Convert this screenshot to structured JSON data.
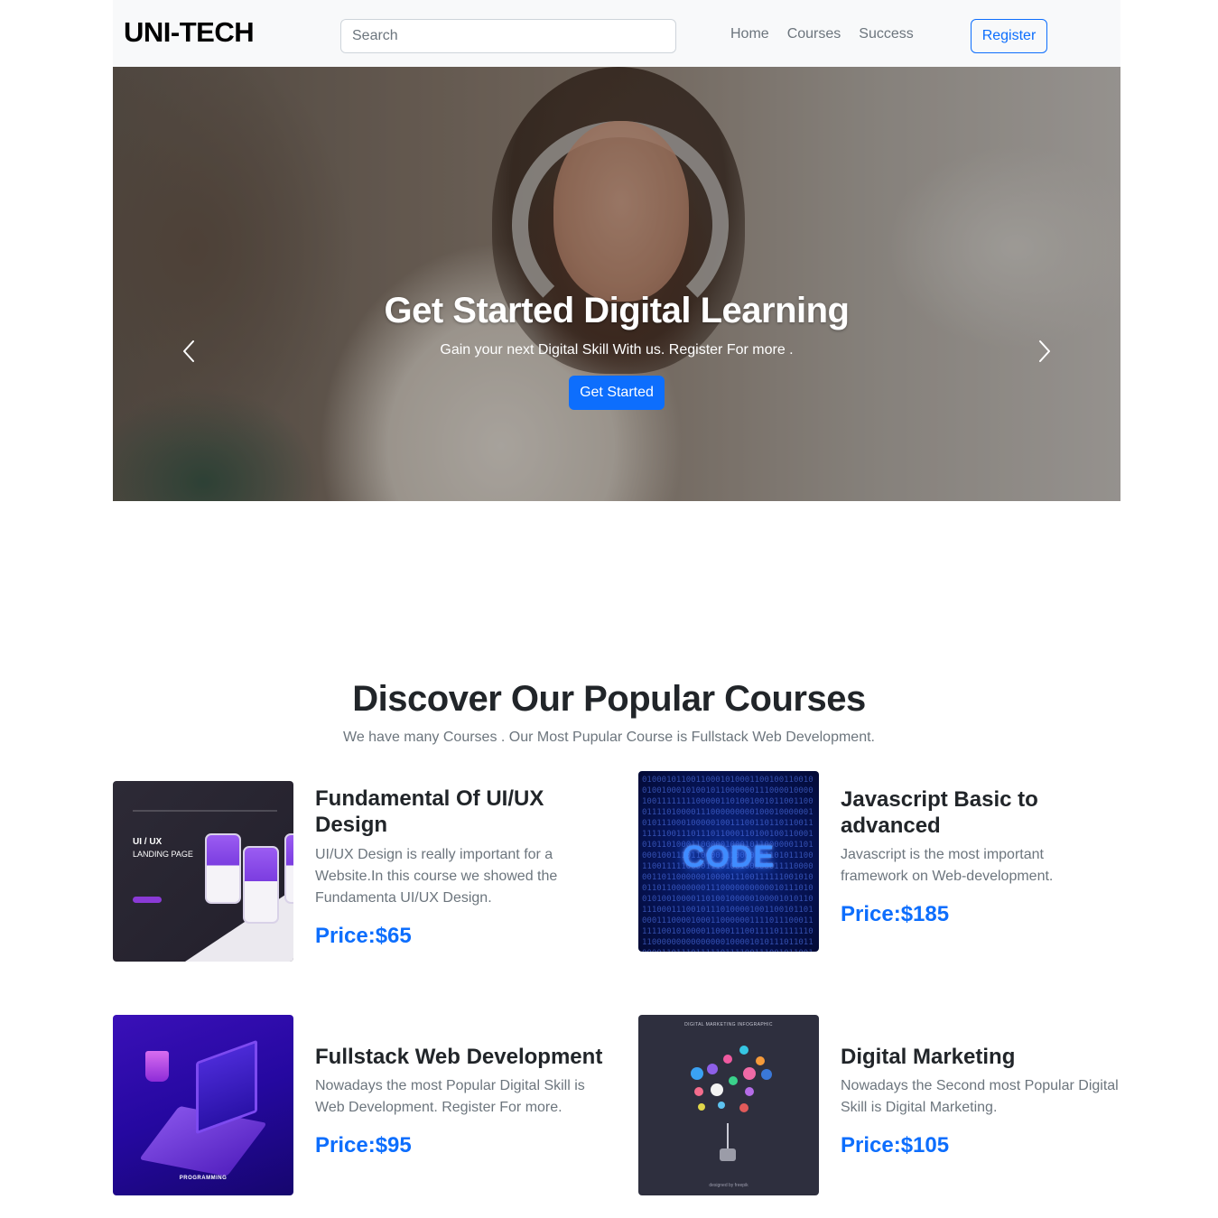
{
  "brand": "UNI-TECH",
  "search": {
    "placeholder": "Search"
  },
  "nav": {
    "items": [
      "Home",
      "Courses",
      "Success"
    ],
    "register_label": "Register"
  },
  "hero": {
    "title": "Get Started Digital Learning",
    "subtitle": "Gain your next Digital Skill With us. Register For more .",
    "button_label": "Get Started"
  },
  "courses_section": {
    "title": "Discover Our Popular Courses",
    "subtitle": "We have many Courses . Our Most Pupular Course is Fullstack Web Development."
  },
  "courses": [
    {
      "title": "Fundamental Of UI/UX Design",
      "description": "UI/UX Design is really important for a Website.In this course we showed the Fundamenta UI/UX Design.",
      "price": "Price:$65",
      "thumb": {
        "heading": "UI / UX",
        "subheading": "LANDING PAGE"
      }
    },
    {
      "title": "Javascript Basic to advanced",
      "description": "Javascript is the most important framework on Web-development.",
      "price": "Price:$185",
      "thumb": {
        "word": "CODE"
      }
    },
    {
      "title": "Fullstack Web Development",
      "description": "Nowadays the most Popular Digital Skill is Web Development. Register For more.",
      "price": "Price:$95",
      "thumb": {
        "caption": "PROGRAMMING"
      }
    },
    {
      "title": "Digital Marketing",
      "description": "Nowadays the Second most Popular Digital Skill is Digital Marketing.",
      "price": "Price:$105",
      "thumb": {
        "caption": "DIGITAL MARKETING INFOGRAPHIC",
        "credit": "designed by freepik"
      }
    }
  ],
  "colors": {
    "primary": "#0d6efd",
    "muted": "#6c757d",
    "navbar_bg": "#f8f9fa"
  },
  "icons": {
    "prev": "chevron-left-icon",
    "next": "chevron-right-icon"
  }
}
